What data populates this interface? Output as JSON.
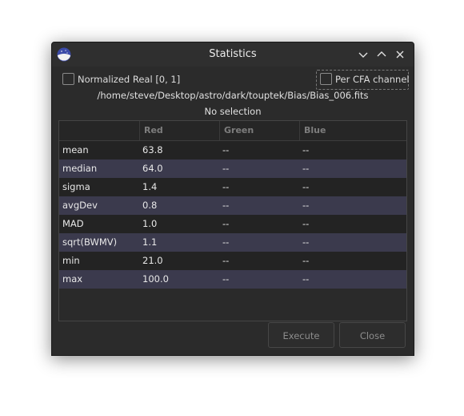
{
  "window": {
    "title": "Statistics"
  },
  "options": {
    "normalized_label": "Normalized Real [0, 1]",
    "normalized_checked": false,
    "cfa_label": "Per CFA channel",
    "cfa_checked": false
  },
  "file_path": "/home/steve/Desktop/astro/dark/touptek/Bias/Bias_006.fits",
  "selection_text": "No selection",
  "table": {
    "columns": [
      "",
      "Red",
      "Green",
      "Blue"
    ],
    "rows": [
      {
        "name": "mean",
        "red": "63.8",
        "green": "--",
        "blue": "--"
      },
      {
        "name": "median",
        "red": "64.0",
        "green": "--",
        "blue": "--"
      },
      {
        "name": "sigma",
        "red": "1.4",
        "green": "--",
        "blue": "--"
      },
      {
        "name": "avgDev",
        "red": "0.8",
        "green": "--",
        "blue": "--"
      },
      {
        "name": "MAD",
        "red": "1.0",
        "green": "--",
        "blue": "--"
      },
      {
        "name": "sqrt(BWMV)",
        "red": "1.1",
        "green": "--",
        "blue": "--"
      },
      {
        "name": "min",
        "red": "21.0",
        "green": "--",
        "blue": "--"
      },
      {
        "name": "max",
        "red": "100.0",
        "green": "--",
        "blue": "--"
      }
    ]
  },
  "buttons": {
    "execute_label": "Execute",
    "close_label": "Close"
  },
  "icons": {
    "app": "siril-app-icon",
    "minimize": "chevron-down-icon",
    "maximize": "chevron-up-icon",
    "close": "close-icon"
  }
}
